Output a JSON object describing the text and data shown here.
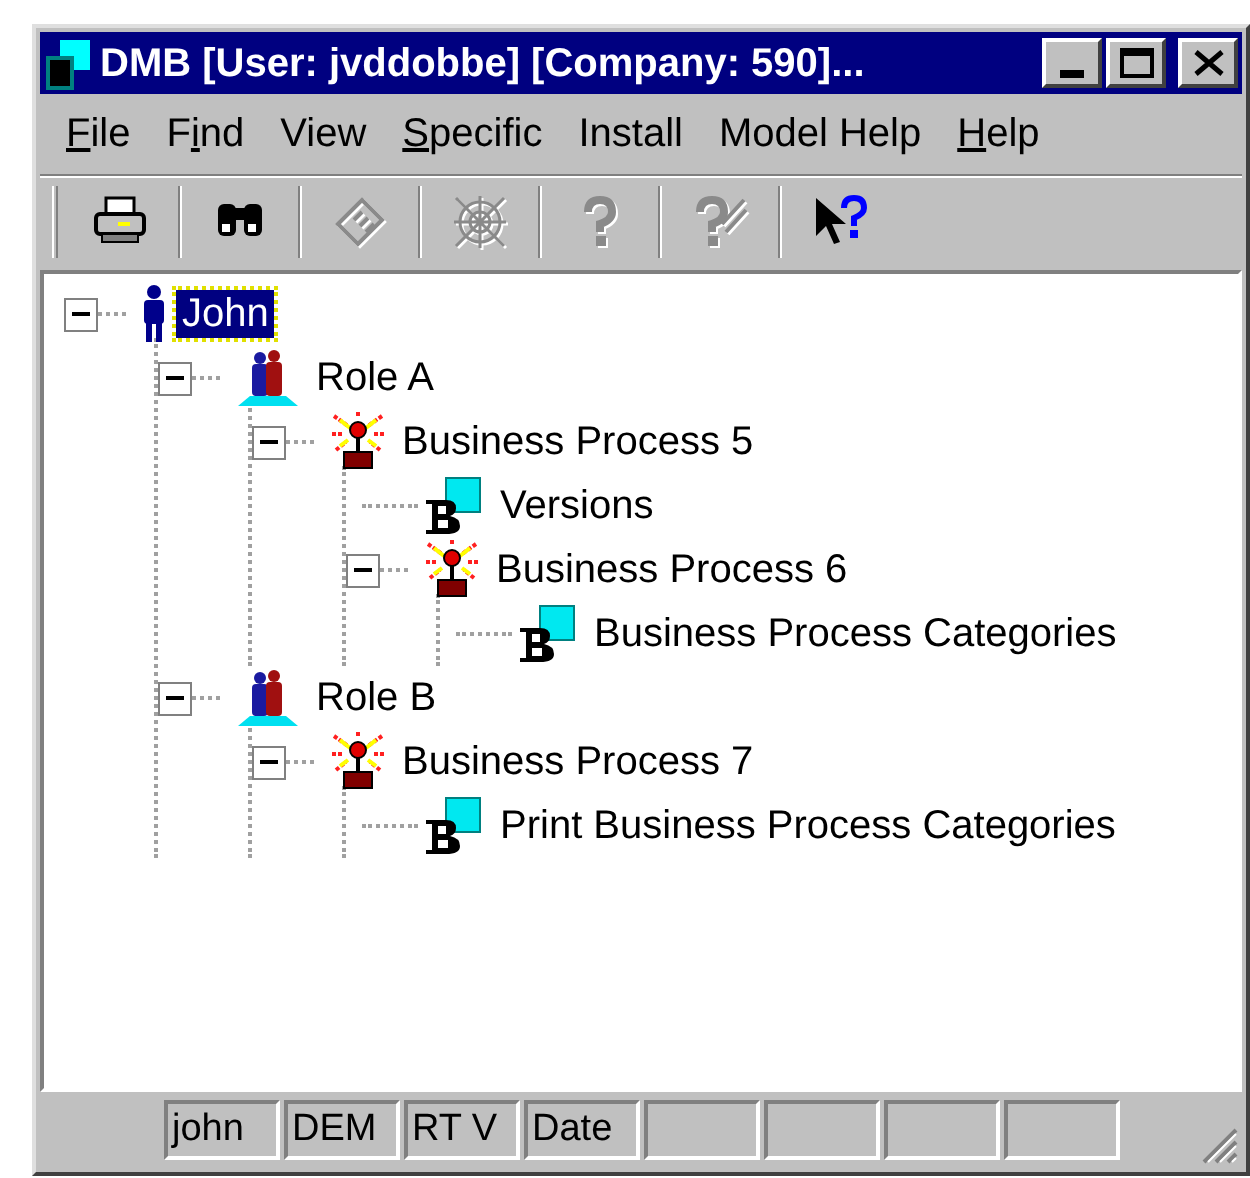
{
  "window": {
    "title": "DMB [User: jvddobbe] [Company: 590]..."
  },
  "menu": [
    {
      "access_key": "F",
      "suffix": "ile"
    },
    {
      "prefix": "F",
      "access_key": "i",
      "suffix": "nd"
    },
    {
      "label": "View"
    },
    {
      "access_key": "S",
      "suffix": "pecific"
    },
    {
      "label": "Install"
    },
    {
      "label": "Model Help"
    },
    {
      "access_key": "H",
      "suffix": "elp"
    }
  ],
  "toolbar": [
    {
      "kind": "print",
      "disabled": false
    },
    {
      "kind": "find",
      "disabled": false
    },
    {
      "kind": "card",
      "disabled": true
    },
    {
      "kind": "web",
      "disabled": true
    },
    {
      "kind": "help",
      "disabled": true
    },
    {
      "kind": "help-check",
      "disabled": true
    },
    {
      "kind": "context-help",
      "disabled": false
    }
  ],
  "tree": [
    {
      "label": "John",
      "kind": "person",
      "selected": true,
      "expanded": true,
      "children": [
        {
          "label": "Role A",
          "kind": "role",
          "selected": false,
          "expanded": true,
          "children": [
            {
              "label": "Business Process 5",
              "kind": "process",
              "selected": false,
              "expanded": true,
              "children": [
                {
                  "label": "Versions",
                  "kind": "document",
                  "selected": false
                },
                {
                  "label": "Business Process 6",
                  "kind": "process",
                  "selected": false,
                  "expanded": true,
                  "children": [
                    {
                      "label": "Business Process Categories",
                      "kind": "document",
                      "selected": false
                    }
                  ]
                }
              ]
            }
          ]
        },
        {
          "label": "Role B",
          "kind": "role",
          "selected": false,
          "expanded": true,
          "children": [
            {
              "label": "Business Process 7",
              "kind": "process",
              "selected": false,
              "expanded": true,
              "children": [
                {
                  "label": "Print Business Process Categories",
                  "kind": "document",
                  "selected": false
                }
              ]
            }
          ]
        }
      ]
    }
  ],
  "status_bar": [
    "john",
    "DEM",
    "RT V",
    "Date"
  ]
}
